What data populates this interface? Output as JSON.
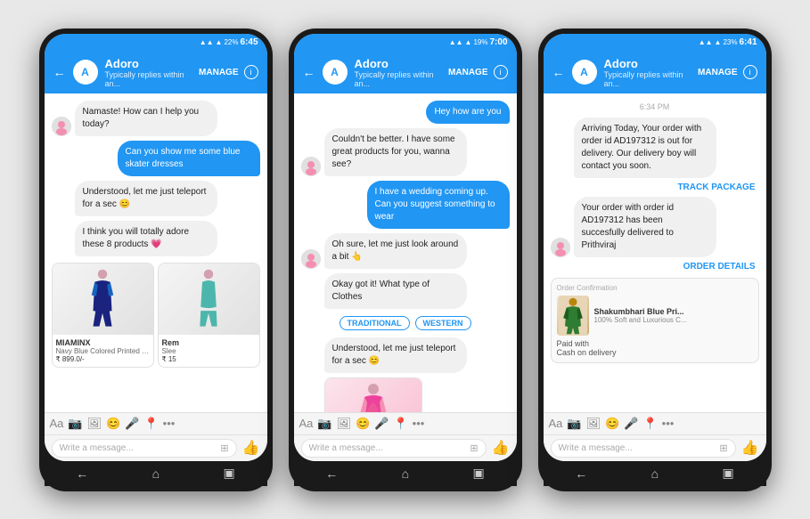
{
  "phones": [
    {
      "id": "phone1",
      "status": {
        "left": "",
        "battery": "22%",
        "time": "6:45",
        "signal_icon": "▲▲▲",
        "wifi_icon": "wifi",
        "battery_icon": "🔋"
      },
      "header": {
        "name": "Adoro",
        "sub": "Typically replies within an...",
        "manage": "MANAGE"
      },
      "messages": [
        {
          "type": "received",
          "text": "Namaste! How can I help you today?",
          "showAvatar": true
        },
        {
          "type": "sent",
          "text": "Can you show me some blue skater dresses"
        },
        {
          "type": "received",
          "text": "Understood, let me just teleport for a sec 😊",
          "showAvatar": false
        },
        {
          "type": "received",
          "text": "I think you will totally adore these 8 products 💗",
          "showAvatar": false
        }
      ],
      "product": {
        "brand": "MIAMINX",
        "desc": "Navy Blue Colored Printed Skater Dr",
        "price": "₹ 899.0/-",
        "brand2": "Rem",
        "desc2": "Slee",
        "price2": "₹ 15"
      },
      "compose": "Write a message..."
    },
    {
      "id": "phone2",
      "status": {
        "battery": "19%",
        "time": "7:00"
      },
      "header": {
        "name": "Adoro",
        "sub": "Typically replies within an...",
        "manage": "MANAGE"
      },
      "messages": [
        {
          "type": "sent",
          "text": "Hey how are you"
        },
        {
          "type": "received",
          "text": "Couldn't be better. I have some great products for you, wanna see?",
          "showAvatar": true
        },
        {
          "type": "sent",
          "text": "I have a wedding coming up. Can you suggest something to wear"
        },
        {
          "type": "received",
          "text": "Oh sure, let me just look around a bit 👆",
          "showAvatar": true
        },
        {
          "type": "received",
          "text": "Okay got it! What type of Clothes",
          "showAvatar": false
        },
        {
          "type": "quickreplies",
          "options": [
            "TRADITIONAL",
            "WESTERN"
          ]
        },
        {
          "type": "received",
          "text": "Understood, let me just teleport for a sec 😊",
          "showAvatar": false
        }
      ],
      "compose": "Write a message..."
    },
    {
      "id": "phone3",
      "status": {
        "battery": "23%",
        "time": "6:41"
      },
      "header": {
        "name": "Adoro",
        "sub": "Typically replies within an...",
        "manage": "MANAGE"
      },
      "timestamp": "6:34 PM",
      "messages": [
        {
          "type": "received-long",
          "text": "Arriving Today, Your order with order id AD197312 is out for delivery. Our delivery boy will contact you soon.",
          "showAvatar": false
        },
        {
          "type": "track",
          "text": "TRACK PACKAGE"
        },
        {
          "type": "received",
          "text": "Your order with order id AD197312 has been succesfully delivered to Prithviraj",
          "showAvatar": true
        },
        {
          "type": "order-link",
          "text": "ORDER DETAILS"
        }
      ],
      "order": {
        "label": "Order Confirmation",
        "product_name": "Shakumbhari Blue Pri...",
        "product_sub": "100% Soft and Luxurious C...",
        "paid_label": "Paid with",
        "paid_method": "Cash on delivery"
      },
      "compose": "Write a message..."
    }
  ],
  "icons": {
    "back": "←",
    "info": "i",
    "aa": "Aa",
    "camera": "📷",
    "gallery": "🖼",
    "emoji": "😊",
    "mic": "🎤",
    "location": "📍",
    "more": "•••",
    "sticker": "⊞",
    "like": "👍",
    "back_nav": "←",
    "home_nav": "⌂",
    "recent_nav": "▣"
  }
}
